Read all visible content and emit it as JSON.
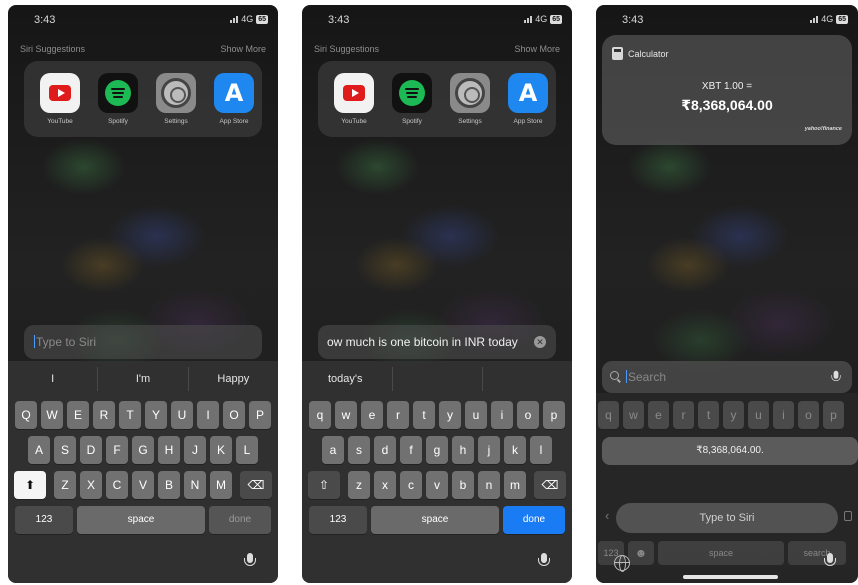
{
  "status": {
    "time": "3:43",
    "network": "4G",
    "battery": "65"
  },
  "suggestions": {
    "title": "Siri Suggestions",
    "show_more": "Show More",
    "apps": [
      {
        "label": "YouTube",
        "icon": "youtube-icon"
      },
      {
        "label": "Spotify",
        "icon": "spotify-icon"
      },
      {
        "label": "Settings",
        "icon": "settings-icon"
      },
      {
        "label": "App Store",
        "icon": "app-store-icon"
      }
    ]
  },
  "screen1": {
    "input_placeholder": "Type to Siri",
    "predictions": [
      "I",
      "I'm",
      "Happy"
    ]
  },
  "screen2": {
    "input_value": "ow much is one bitcoin in INR today",
    "predictions": [
      "today's",
      "",
      ""
    ]
  },
  "keyboard": {
    "row1": [
      "Q",
      "W",
      "E",
      "R",
      "T",
      "Y",
      "U",
      "I",
      "O",
      "P"
    ],
    "row2": [
      "A",
      "S",
      "D",
      "F",
      "G",
      "H",
      "J",
      "K",
      "L"
    ],
    "row3": [
      "Z",
      "X",
      "C",
      "V",
      "B",
      "N",
      "M"
    ],
    "row1_lower": [
      "q",
      "w",
      "e",
      "r",
      "t",
      "y",
      "u",
      "i",
      "o",
      "p"
    ],
    "row2_lower": [
      "a",
      "s",
      "d",
      "f",
      "g",
      "h",
      "j",
      "k",
      "l"
    ],
    "row3_lower": [
      "z",
      "x",
      "c",
      "v",
      "b",
      "n",
      "m"
    ],
    "numbers_label": "123",
    "space_label": "space",
    "done_label": "done",
    "shift_glyph": "⇧",
    "delete_glyph": "⌫"
  },
  "screen3": {
    "widget_app": "Calculator",
    "expression": "XBT 1.00 =",
    "result": "₹8,368,064.00",
    "source": "yahoo!finance",
    "search_placeholder": "Search",
    "row1_partial": [
      "q",
      "w",
      "e",
      "r",
      "t",
      "y",
      "u",
      "i",
      "o",
      "p"
    ],
    "result_suggestion": "₹8,368,064.00.",
    "type_to_siri": "Type to Siri",
    "numbers_label": "123",
    "space_label": "space",
    "search_key": "search",
    "emoji_glyph": "☻",
    "left_arrow": "‹"
  },
  "colors": {
    "accent": "#1a7cf5",
    "caret": "#4a9cff"
  }
}
